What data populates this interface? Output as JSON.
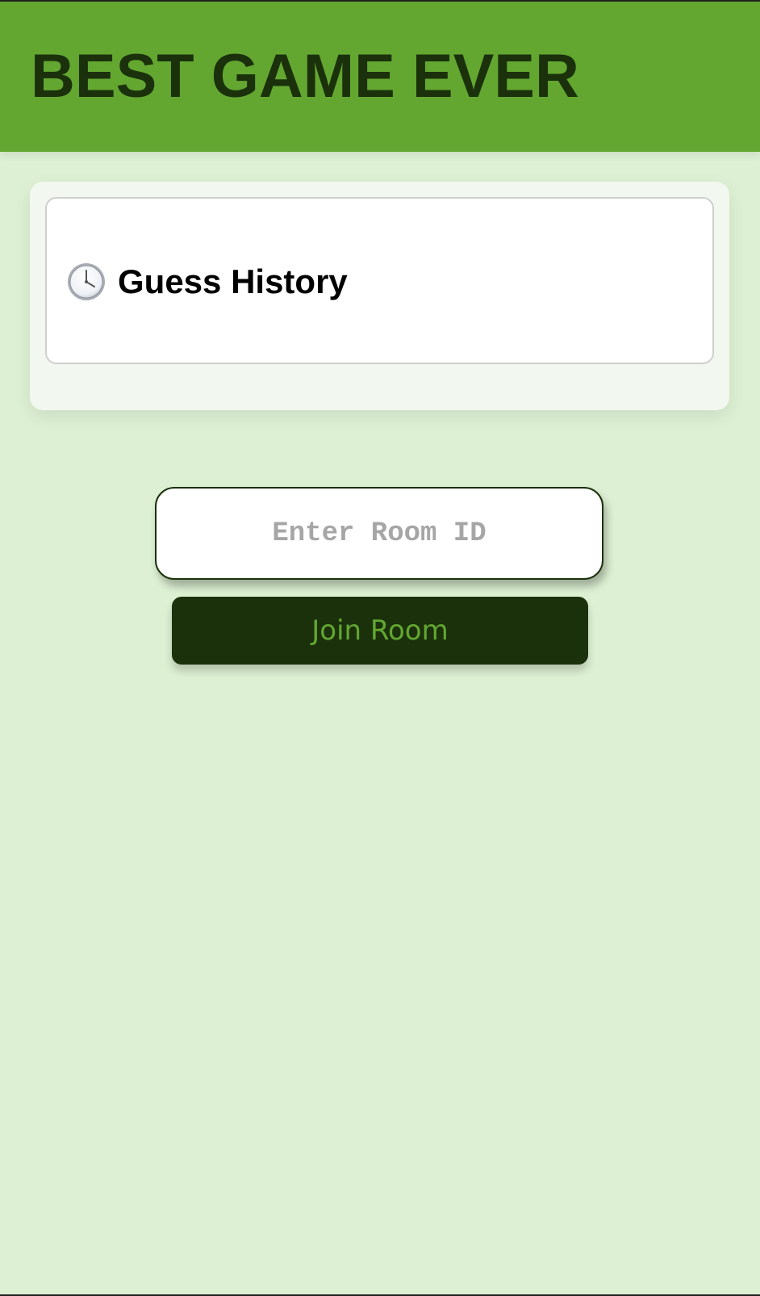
{
  "header": {
    "title": "BEST GAME EVER"
  },
  "guess_history": {
    "icon": "clock-icon",
    "title": "Guess History"
  },
  "room_form": {
    "input_value": "",
    "input_placeholder": "Enter Room ID",
    "join_label": "Join Room"
  },
  "colors": {
    "background": "#ddf0d3",
    "header": "#63a731",
    "dark_green": "#1b310c",
    "panel": "#f2f7ef",
    "card": "#ffffff"
  }
}
